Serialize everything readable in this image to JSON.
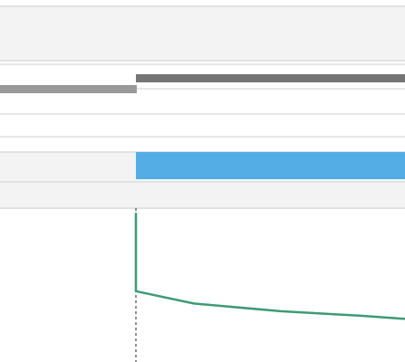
{
  "colors": {
    "panel_bg": "#f3f3f3",
    "border": "#e2e2e2",
    "bar_dark": "#757575",
    "bar_light": "#999999",
    "accent_blue": "#55ade6",
    "line_green": "#3d9a74",
    "marker_line": "#222222"
  },
  "progress": {
    "top_track_fraction": 1.0,
    "left_track_fraction": 0.34
  },
  "chart_data": {
    "type": "line",
    "series": [
      {
        "values": [
          0.97,
          0.46,
          0.38,
          0.33,
          0.3,
          0.28
        ]
      }
    ],
    "x": [
      0,
      1,
      2,
      3,
      4,
      5
    ]
  }
}
